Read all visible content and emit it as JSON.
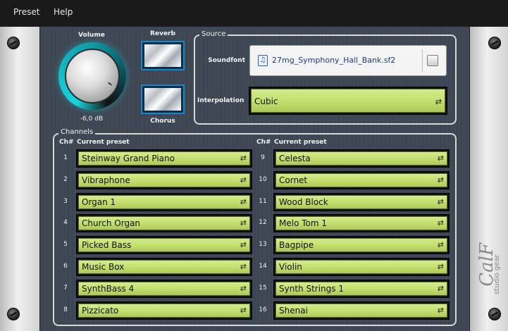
{
  "menu": {
    "items": [
      "Preset",
      "Help"
    ]
  },
  "controls": {
    "volume_label": "Volume",
    "volume_value": "-6,0 dB",
    "reverb_label": "Reverb",
    "chorus_label": "Chorus"
  },
  "source": {
    "title": "Source",
    "soundfont_label": "Soundfont",
    "soundfont_file": "27mg_Symphony_Hall_Bank.sf2",
    "interpolation_label": "Interpolation",
    "interpolation_value": "Cubic"
  },
  "channels": {
    "title": "Channels",
    "ch_header": "Ch#",
    "preset_header": "Current preset",
    "left": [
      {
        "n": "1",
        "preset": "Steinway Grand Piano"
      },
      {
        "n": "2",
        "preset": "Vibraphone"
      },
      {
        "n": "3",
        "preset": "Organ 1"
      },
      {
        "n": "4",
        "preset": "Church Organ"
      },
      {
        "n": "5",
        "preset": "Picked Bass"
      },
      {
        "n": "6",
        "preset": "Music Box"
      },
      {
        "n": "7",
        "preset": "SynthBass 4"
      },
      {
        "n": "8",
        "preset": "Pizzicato"
      }
    ],
    "right": [
      {
        "n": "9",
        "preset": "Celesta"
      },
      {
        "n": "10",
        "preset": "Cornet"
      },
      {
        "n": "11",
        "preset": "Wood Block"
      },
      {
        "n": "12",
        "preset": "Melo Tom 1"
      },
      {
        "n": "13",
        "preset": "Bagpipe"
      },
      {
        "n": "14",
        "preset": "Violin"
      },
      {
        "n": "15",
        "preset": "Synth Strings 1"
      },
      {
        "n": "16",
        "preset": "Shenai"
      }
    ]
  },
  "branding": {
    "logo": "CalF",
    "tagline": "studio gear"
  },
  "icons": {
    "soundfont": "music-file-icon",
    "browse": "folder-browse-icon",
    "dropdown": "swap-arrows-icon"
  },
  "colors": {
    "accent": "#19d5df",
    "lcd": "#c3e06f",
    "panel": "#404856"
  }
}
